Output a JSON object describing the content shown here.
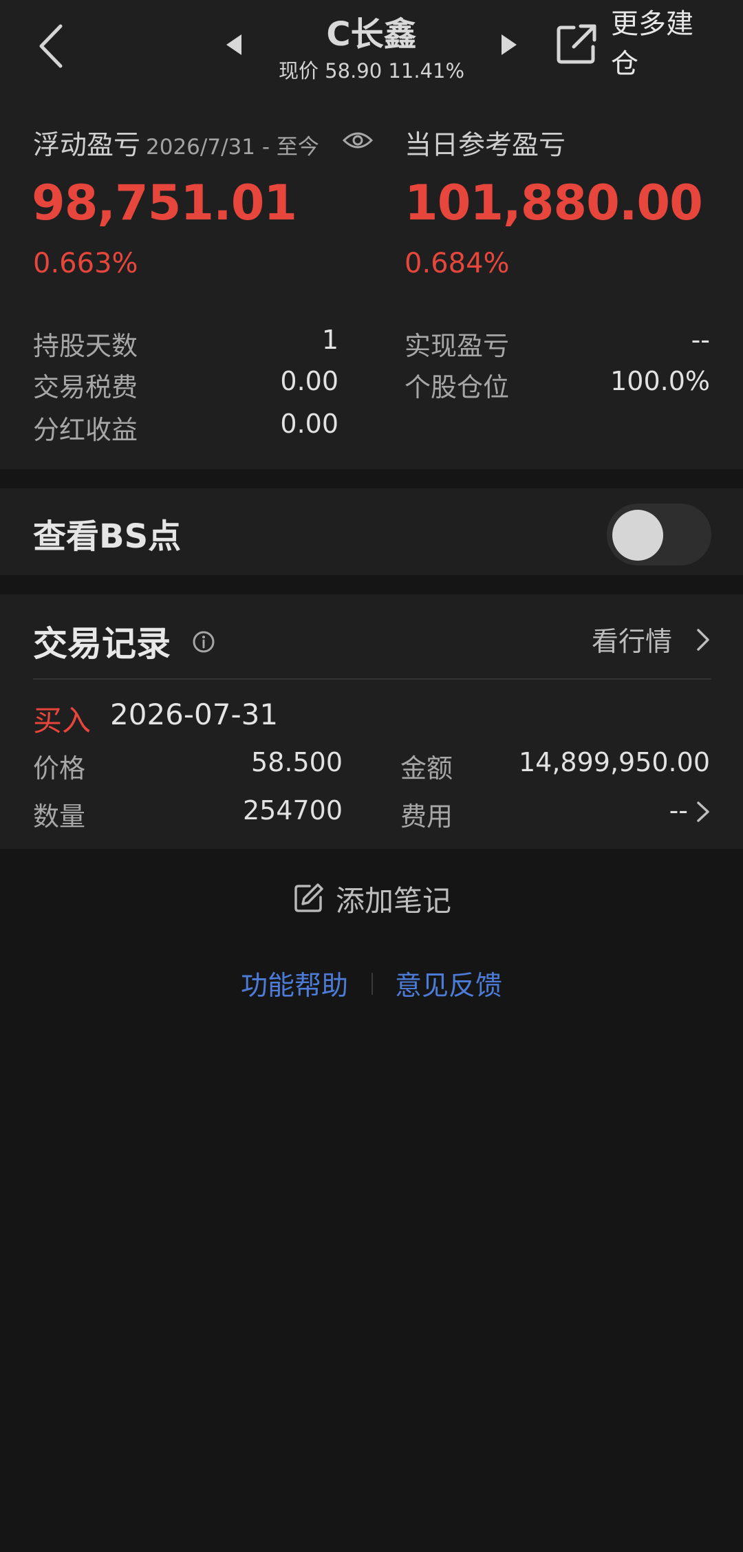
{
  "header": {
    "title": "C长鑫",
    "subtitle": "现价 58.90 11.41%",
    "more_label": "更多建仓"
  },
  "summary": {
    "floating_label": "浮动盈亏",
    "floating_date": "2026/7/31 - 至今",
    "floating_value": "98,751.01",
    "floating_pct": "0.663%",
    "daily_label": "当日参考盈亏",
    "daily_value": "101,880.00",
    "daily_pct": "0.684%",
    "left_stats": [
      {
        "label": "持股天数",
        "value": "1"
      },
      {
        "label": "交易税费",
        "value": "0.00"
      },
      {
        "label": "分红收益",
        "value": "0.00"
      }
    ],
    "right_stats": [
      {
        "label": "实现盈亏",
        "value": "--"
      },
      {
        "label": "个股仓位",
        "value": "100.0%"
      }
    ]
  },
  "bs": {
    "label": "查看BS点",
    "enabled": false
  },
  "trade": {
    "title": "交易记录",
    "market_link": "看行情",
    "record": {
      "side": "买入",
      "date": "2026-07-31",
      "price_label": "价格",
      "price": "58.500",
      "amount_label": "金额",
      "amount": "14,899,950.00",
      "qty_label": "数量",
      "qty": "254700",
      "fee_label": "费用",
      "fee": "--"
    }
  },
  "footer": {
    "add_note": "添加笔记",
    "help": "功能帮助",
    "feedback": "意见反馈"
  },
  "colors": {
    "profit_red": "#e6463c",
    "link_blue": "#4d7cd8",
    "background": "#151515",
    "card": "#1f1f1f"
  }
}
